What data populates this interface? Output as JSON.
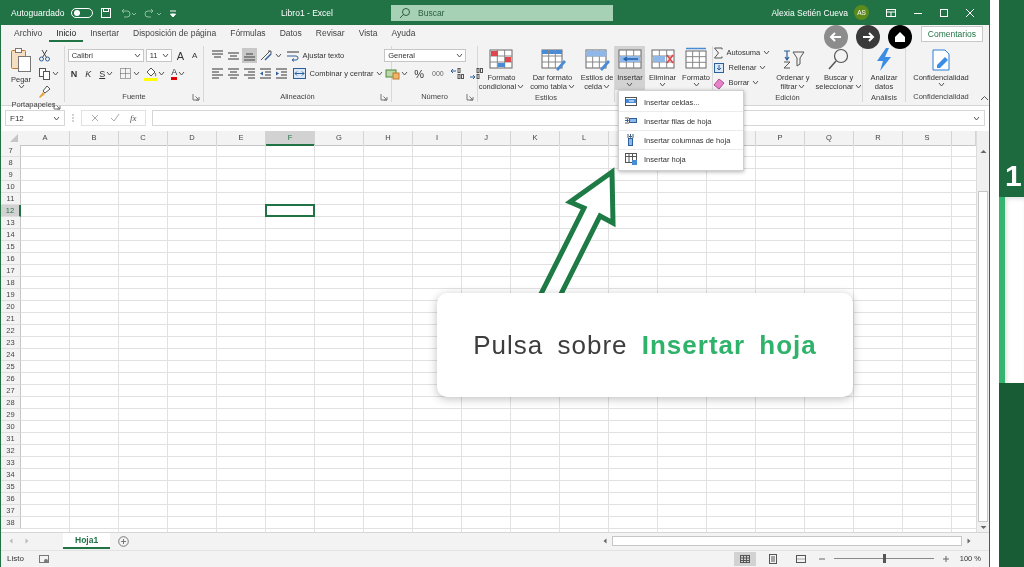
{
  "title_bar": {
    "autosave_label": "Autoguardado",
    "autosave_on": false,
    "title": "Libro1  -  Excel",
    "search_placeholder": "Buscar",
    "user_name": "Alexia Setién Cueva",
    "user_initials": "AS"
  },
  "ribbon_tabs": [
    {
      "label": "Archivo",
      "selected": false
    },
    {
      "label": "Inicio",
      "selected": true
    },
    {
      "label": "Insertar",
      "selected": false
    },
    {
      "label": "Disposición de página",
      "selected": false
    },
    {
      "label": "Fórmulas",
      "selected": false
    },
    {
      "label": "Datos",
      "selected": false
    },
    {
      "label": "Revisar",
      "selected": false
    },
    {
      "label": "Vista",
      "selected": false
    },
    {
      "label": "Ayuda",
      "selected": false
    }
  ],
  "comments_button": "Comentarios",
  "ribbon_groups": [
    {
      "label": "Portapapeles",
      "launcher": true,
      "items": [
        {
          "kind": "big",
          "lines": [
            "Pegar"
          ],
          "dropdown": true,
          "selected": false
        },
        {
          "kind": "stack",
          "rows": [
            {
              "controls": [
                {
                  "kind": "icon"
                }
              ]
            },
            {
              "controls": [
                {
                  "kind": "icon",
                  "dropdown": true
                }
              ]
            },
            {
              "controls": [
                {
                  "kind": "icon"
                }
              ]
            }
          ]
        }
      ]
    },
    {
      "label": "Fuente",
      "launcher": true,
      "items": [
        {
          "kind": "stack",
          "rows": [
            {
              "controls": [
                {
                  "kind": "field",
                  "value": "Calibri"
                },
                {
                  "kind": "field",
                  "value": "11"
                },
                {
                  "kind": "text",
                  "label": "A"
                },
                {
                  "kind": "text",
                  "label": "A"
                }
              ]
            },
            {
              "controls": [
                {
                  "kind": "text",
                  "label": "N"
                },
                {
                  "kind": "text",
                  "label": "K"
                },
                {
                  "kind": "text",
                  "label": "S",
                  "dropdown": true
                },
                {
                  "kind": "icon",
                  "dropdown": true
                },
                {
                  "kind": "icon",
                  "color": "#ffff00",
                  "dropdown": true
                },
                {
                  "kind": "text",
                  "label": "A",
                  "color": "#e00000",
                  "dropdown": true
                }
              ]
            }
          ]
        }
      ]
    },
    {
      "label": "Alineación",
      "launcher": true,
      "items": [
        {
          "kind": "stack",
          "rows": [
            {
              "controls": [
                {
                  "kind": "icon",
                  "selected": false
                },
                {
                  "kind": "icon",
                  "selected": false
                },
                {
                  "kind": "icon",
                  "selected": true
                },
                {
                  "kind": "icon",
                  "dropdown": true
                },
                {
                  "kind": "button",
                  "label": "Ajustar texto"
                }
              ]
            },
            {
              "controls": [
                {
                  "kind": "icon",
                  "selected": false
                },
                {
                  "kind": "icon",
                  "selected": false
                },
                {
                  "kind": "icon",
                  "selected": false
                },
                {
                  "kind": "icon"
                },
                {
                  "kind": "icon"
                },
                {
                  "kind": "button",
                  "label": "Combinar y centrar",
                  "dropdown": true
                }
              ]
            }
          ]
        }
      ]
    },
    {
      "label": "Número",
      "launcher": true,
      "items": [
        {
          "kind": "stack",
          "rows": [
            {
              "controls": [
                {
                  "kind": "field",
                  "value": "General"
                }
              ]
            },
            {
              "controls": [
                {
                  "kind": "icon",
                  "dropdown": true
                },
                {
                  "kind": "text",
                  "label": "%"
                },
                {
                  "kind": "text",
                  "label": "000"
                },
                {
                  "kind": "icon"
                },
                {
                  "kind": "icon"
                }
              ]
            }
          ]
        }
      ]
    },
    {
      "label": "Estilos",
      "items": [
        {
          "kind": "big",
          "lines": [
            "Formato",
            "condicional"
          ],
          "dropdown": true,
          "selected": false
        },
        {
          "kind": "big",
          "lines": [
            "Dar formato",
            "como tabla"
          ],
          "dropdown": true,
          "selected": false
        },
        {
          "kind": "big",
          "lines": [
            "Estilos de",
            "celda"
          ],
          "dropdown": true,
          "selected": false
        }
      ]
    },
    {
      "items": [
        {
          "kind": "big",
          "lines": [
            "Insertar"
          ],
          "dropdown": true,
          "selected": true
        },
        {
          "kind": "big",
          "lines": [
            "Eliminar"
          ],
          "dropdown": true,
          "selected": false
        },
        {
          "kind": "big",
          "lines": [
            "Formato"
          ],
          "dropdown": true,
          "selected": false
        }
      ]
    },
    {
      "label": "Edición",
      "items": [
        {
          "kind": "stack",
          "rows": [
            {
              "controls": [
                {
                  "kind": "button",
                  "label": "Autosuma",
                  "dropdown": true
                }
              ]
            },
            {
              "controls": [
                {
                  "kind": "button",
                  "label": "Rellenar",
                  "dropdown": true
                }
              ]
            },
            {
              "controls": [
                {
                  "kind": "button",
                  "label": "Borrar",
                  "dropdown": true
                }
              ]
            }
          ]
        },
        {
          "kind": "big",
          "lines": [
            "Ordenar y",
            "filtrar"
          ],
          "dropdown": true,
          "selected": false
        },
        {
          "kind": "big",
          "lines": [
            "Buscar y",
            "seleccionar"
          ],
          "dropdown": true,
          "selected": false
        }
      ]
    },
    {
      "label": "Análisis",
      "items": [
        {
          "kind": "big",
          "lines": [
            "Analizar",
            "datos"
          ],
          "dropdown": false,
          "selected": false
        }
      ]
    },
    {
      "label": "Confidencialidad",
      "items": [
        {
          "kind": "big",
          "lines": [
            "Confidencialidad"
          ],
          "dropdown": true,
          "selected": false
        }
      ]
    }
  ],
  "insert_menu": [
    {
      "label": "Insertar celdas..."
    },
    {
      "label": "Insertar filas de hoja"
    },
    {
      "label": "Insertar columnas de hoja"
    },
    {
      "label": "Insertar hoja"
    }
  ],
  "formula_bar": {
    "name_box": "F12",
    "function_label": "fx"
  },
  "columns": [
    {
      "label": "A",
      "selected": false
    },
    {
      "label": "B",
      "selected": false
    },
    {
      "label": "C",
      "selected": false
    },
    {
      "label": "D",
      "selected": false
    },
    {
      "label": "E",
      "selected": false
    },
    {
      "label": "F",
      "selected": true
    },
    {
      "label": "G",
      "selected": false
    },
    {
      "label": "H",
      "selected": false
    },
    {
      "label": "I",
      "selected": false
    },
    {
      "label": "J",
      "selected": false
    },
    {
      "label": "K",
      "selected": false
    },
    {
      "label": "L",
      "selected": false
    },
    {
      "selected": false
    },
    {},
    {
      "selected": false
    },
    {
      "label": "P",
      "selected": false
    },
    {
      "label": "Q",
      "selected": false
    },
    {
      "label": "R",
      "selected": false
    },
    {
      "label": "S",
      "selected": false
    }
  ],
  "rows": [
    {
      "label": "7",
      "selected": false
    },
    {
      "label": "8",
      "selected": false
    },
    {
      "label": "9",
      "selected": false
    },
    {
      "label": "10",
      "selected": false
    },
    {
      "label": "11",
      "selected": false
    },
    {
      "label": "12",
      "selected": true
    },
    {
      "label": "13",
      "selected": false
    },
    {
      "label": "14",
      "selected": false
    },
    {
      "label": "15",
      "selected": false
    },
    {
      "label": "16",
      "selected": false
    },
    {
      "label": "17",
      "selected": false
    },
    {
      "label": "18",
      "selected": false
    },
    {
      "label": "19",
      "selected": false
    },
    {
      "label": "20",
      "selected": false
    },
    {
      "label": "21",
      "selected": false
    },
    {
      "label": "22",
      "selected": false
    },
    {
      "label": "23",
      "selected": false
    },
    {
      "label": "24",
      "selected": false
    },
    {
      "label": "25",
      "selected": false
    },
    {
      "label": "26",
      "selected": false
    },
    {
      "label": "27",
      "selected": false
    },
    {
      "label": "28",
      "selected": false
    },
    {
      "label": "29",
      "selected": false
    },
    {
      "label": "30",
      "selected": false
    },
    {
      "label": "31",
      "selected": false
    },
    {
      "label": "32",
      "selected": false
    },
    {
      "label": "33",
      "selected": false
    },
    {
      "label": "34",
      "selected": false
    },
    {
      "label": "35",
      "selected": false
    },
    {
      "label": "36",
      "selected": false
    },
    {
      "label": "37",
      "selected": false
    },
    {
      "label": "38",
      "selected": false
    }
  ],
  "sheet_tabs": [
    {
      "label": "Hoja1",
      "selected": true
    }
  ],
  "status_bar": {
    "status": "Listo",
    "views": [
      {
        "selected": true
      },
      {
        "selected": false
      },
      {
        "selected": false
      }
    ],
    "zoom_slider": {
      "level": 0.5
    },
    "zoom": "100 %"
  },
  "callout": {
    "text": "Pulsa sobre **Insertar hoja**"
  },
  "side_panel": {
    "step_number": "1"
  }
}
